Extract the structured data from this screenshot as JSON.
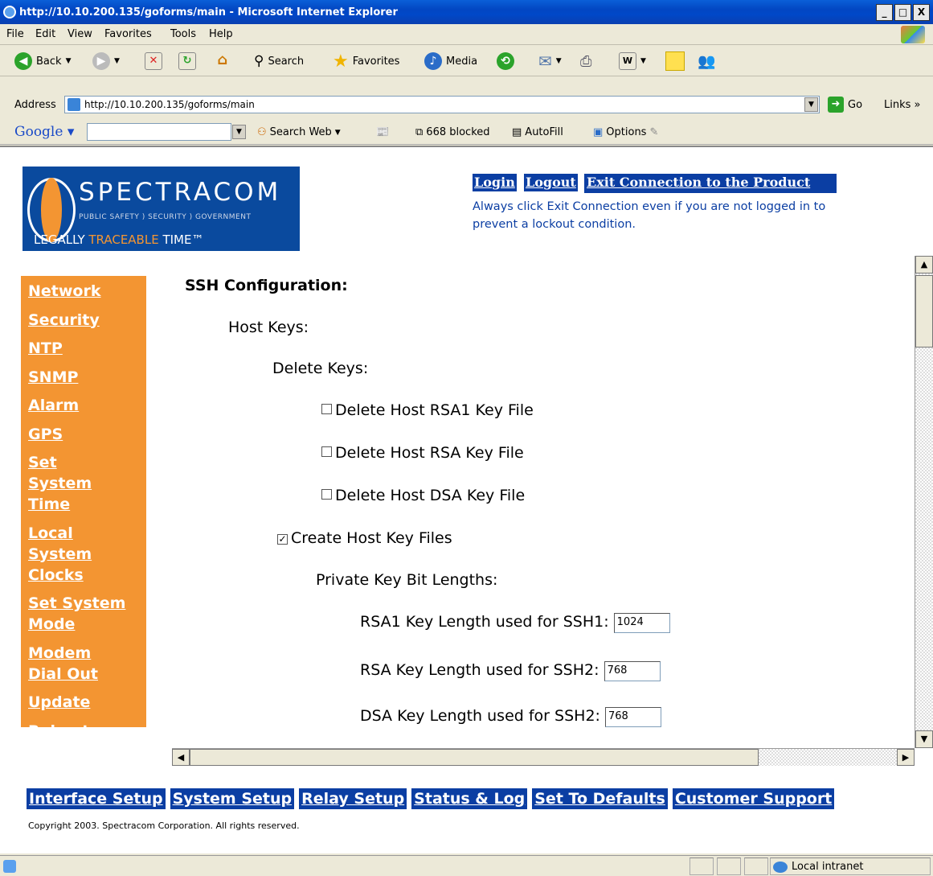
{
  "window": {
    "title": "http://10.10.200.135/goforms/main - Microsoft Internet Explorer",
    "buttons": [
      "_",
      "□",
      "X"
    ]
  },
  "menubar": {
    "items": [
      "File",
      "Edit",
      "View",
      "Favorites",
      "Tools",
      "Help"
    ]
  },
  "toolbar": {
    "back": "Back",
    "search": "Search",
    "favorites": "Favorites",
    "media": "Media"
  },
  "address": {
    "label": "Address",
    "url": "http://10.10.200.135/goforms/main",
    "go": "Go",
    "links": "Links"
  },
  "googlebar": {
    "logo": "Google",
    "search_web": "Search Web",
    "blocked": "668 blocked",
    "autofill": "AutoFill",
    "options": "Options"
  },
  "header": {
    "logo_name": "SPECTRACOM",
    "logo_sub": "PUBLIC SAFETY ) SECURITY ) GOVERNMENT",
    "logo_tag_1": "LEGALLY ",
    "logo_tag_2": "TRACEABLE",
    "logo_tag_3": " TIME™",
    "login": "Login",
    "logout": "Logout",
    "exit": "Exit Connection to the Product",
    "notice": "Always click Exit Connection even if you are not logged in to prevent a lockout condition."
  },
  "sidenav": {
    "items": [
      "Network",
      "Security",
      "NTP",
      "SNMP",
      "Alarm",
      "GPS",
      "Set System Time",
      "Local System Clocks",
      "Set System Mode",
      "Modem Dial Out",
      "Update",
      "Reboot"
    ]
  },
  "form": {
    "title": "SSH Configuration:",
    "host_keys": "Host Keys:",
    "delete_keys": "Delete Keys:",
    "delete_rsa1": "Delete Host RSA1 Key File",
    "delete_rsa": "Delete Host RSA Key File",
    "delete_dsa": "Delete Host DSA Key File",
    "create_keys": "Create Host Key Files",
    "create_keys_checked": true,
    "bit_lengths": "Private Key Bit Lengths:",
    "rsa1_label": "RSA1 Key Length used for SSH1:",
    "rsa1_value": "1024",
    "rsa_label": "RSA Key Length used for SSH2:",
    "rsa_value": "768",
    "dsa_label": "DSA Key Length used for SSH2:",
    "dsa_value": "768"
  },
  "bottomnav": {
    "items": [
      "Interface Setup",
      "System Setup",
      "Relay Setup",
      "Status & Log",
      "Set To Defaults",
      "Customer Support"
    ]
  },
  "footer": {
    "copyright": "Copyright 2003. Spectracom Corporation. All rights reserved."
  },
  "statusbar": {
    "zone": "Local intranet"
  },
  "colors": {
    "nav_orange": "#f39532",
    "link_blue": "#0b3ea3"
  }
}
